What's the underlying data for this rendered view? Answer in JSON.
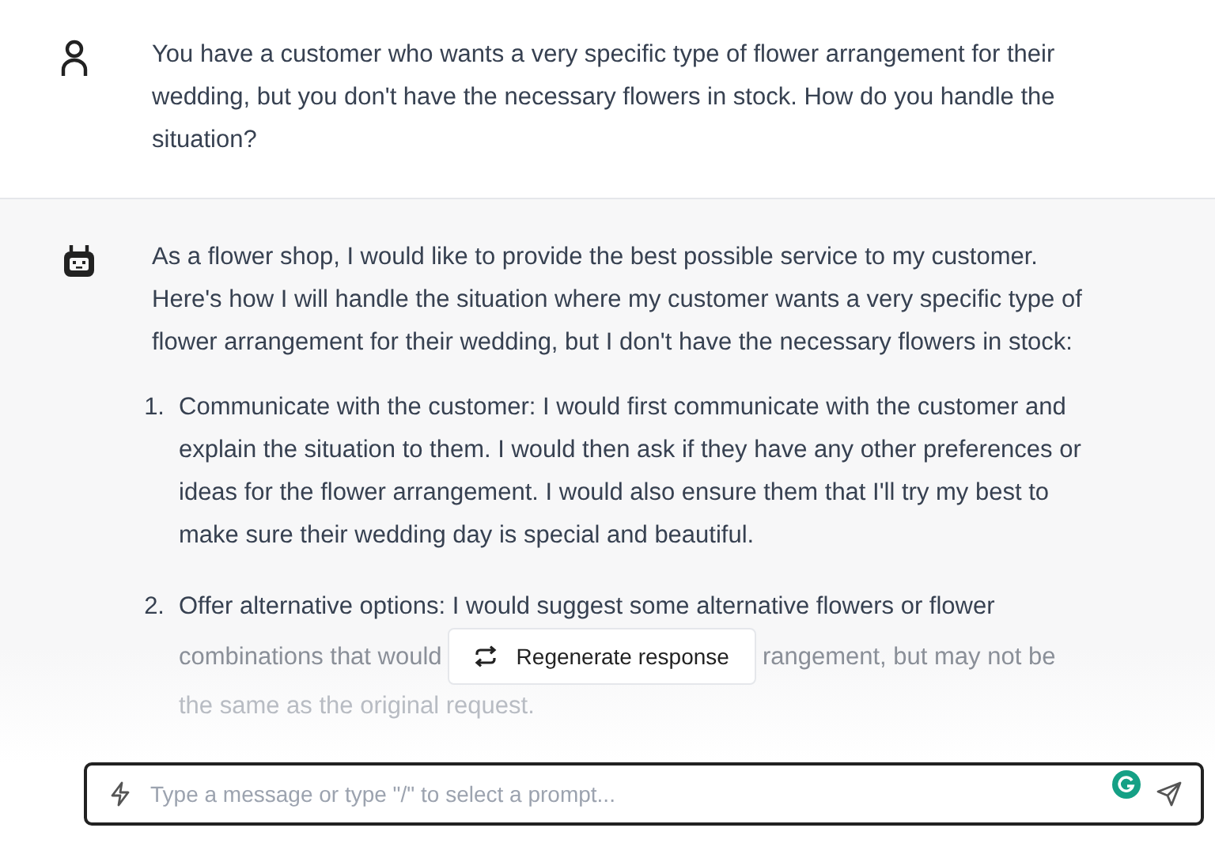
{
  "messages": [
    {
      "kind": "user",
      "text": "You have a customer who wants a very specific type of flower arrangement for their wedding, but you don't have the necessary flowers in stock. How do you handle the situation?"
    },
    {
      "kind": "assistant",
      "intro": "As a flower shop, I would like to provide the best possible service to my customer. Here's how I will handle the situation where my customer wants a very specific type of flower arrangement for their wedding, but I don't have the necessary flowers in stock:",
      "list": [
        {
          "number": "1.",
          "text": "Communicate with the customer: I would first communicate with the customer and explain the situation to them. I would then ask if they have any other preferences or ideas for the flower arrangement. I would also ensure them that I'll try my best to make sure their wedding day is special and beautiful."
        },
        {
          "number": "2.",
          "first_line": "Offer alternative options: I would suggest some alternative flowers or flower",
          "partial_before": "combinations that would",
          "partial_after": "rangement, but may not be",
          "last_line": "the same as the original request."
        }
      ]
    }
  ],
  "regenerate_button": {
    "label": "Regenerate response"
  },
  "input": {
    "placeholder": "Type a message or type \"/\" to select a prompt..."
  }
}
